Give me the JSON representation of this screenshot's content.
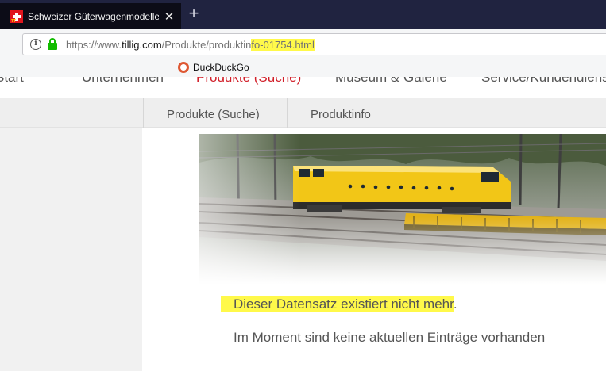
{
  "browser": {
    "tab": {
      "title": "Schweizer Güterwagenmodelle",
      "favicon": "swiss-flag-icon",
      "close_glyph": "✕"
    },
    "new_tab_glyph": "+",
    "urlbar": {
      "scheme": "https://www.",
      "host": "tillig.com",
      "path_plain": "/Produkte/produktin",
      "path_highlighted": "fo-01754.html"
    },
    "bookmarks": [
      {
        "label": "DuckDuckGo",
        "icon": "duckduckgo-icon"
      }
    ]
  },
  "site": {
    "main_nav": [
      "Start",
      "Unternehmen",
      "Produkte (Suche)",
      "Museum & Galerie",
      "Service/Kundendienst"
    ],
    "active_nav": "Produkte (Suche)",
    "sub_nav": [
      "Produkte (Suche)",
      "Produktinfo"
    ],
    "message_primary": "Dieser Datensatz existiert nicht mehr",
    "message_primary_suffix": ".",
    "message_secondary": "Im Moment sind keine aktuellen Einträge vorhanden"
  },
  "colors": {
    "tab_strip": "#202340",
    "active_tab": "#0c0c17",
    "highlight": "#fff94a",
    "nav_active": "#d1202a",
    "locomotive": "#f2c617",
    "secure_lock": "#12bc00"
  }
}
